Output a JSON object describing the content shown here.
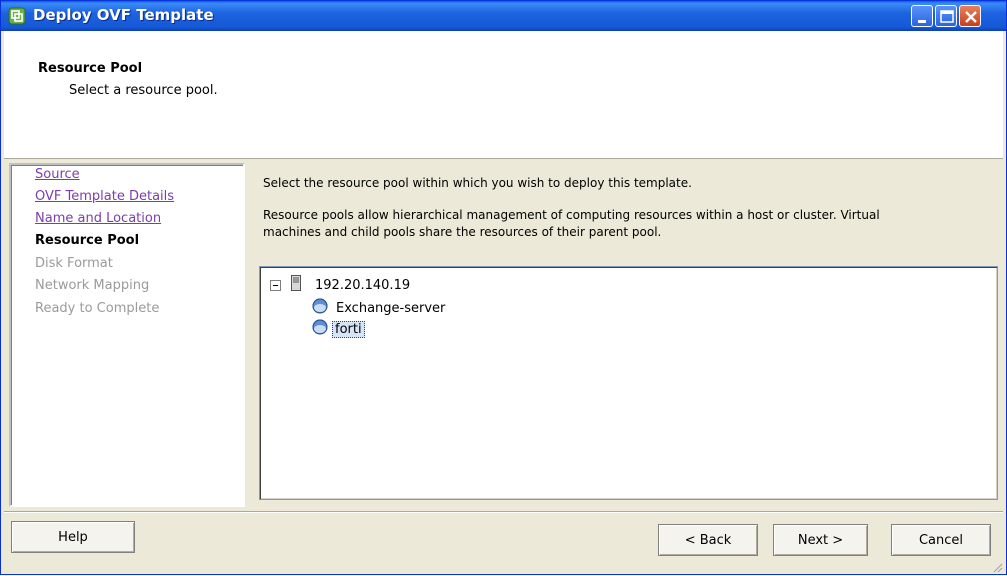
{
  "window": {
    "title": "Deploy OVF Template",
    "titlebar_color": "#1d63e0"
  },
  "header": {
    "title": "Resource Pool",
    "subtitle": "Select a resource pool."
  },
  "nav": {
    "items": [
      {
        "label": "Source",
        "state": "link"
      },
      {
        "label": "OVF Template Details",
        "state": "link"
      },
      {
        "label": "Name and Location",
        "state": "link"
      },
      {
        "label": "Resource Pool",
        "state": "current"
      },
      {
        "label": "Disk Format",
        "state": "disabled"
      },
      {
        "label": "Network Mapping",
        "state": "disabled"
      },
      {
        "label": "Ready to Complete",
        "state": "disabled"
      }
    ]
  },
  "main": {
    "instruction": "Select the resource pool within which you wish to deploy this template.",
    "description_line1": "Resource pools allow hierarchical management of computing resources within a host or cluster. Virtual",
    "description_line2": "machines and child pools share the resources of their parent pool."
  },
  "tree": {
    "host": {
      "label": "192.20.140.19",
      "icon": "server-icon",
      "expanded": true
    },
    "pools": [
      {
        "label": "Exchange-server",
        "icon": "resource-pool-icon",
        "selected": false
      },
      {
        "label": "forti",
        "icon": "resource-pool-icon",
        "selected": true
      }
    ]
  },
  "buttons": {
    "help": "Help",
    "back": "< Back",
    "next": "Next >",
    "cancel": "Cancel"
  }
}
